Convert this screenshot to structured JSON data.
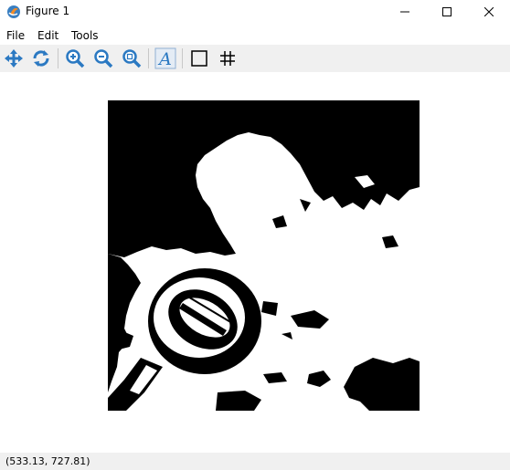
{
  "window": {
    "title": "Figure 1"
  },
  "menu": {
    "items": [
      "File",
      "Edit",
      "Tools"
    ]
  },
  "toolbar": {
    "buttons": [
      "pan-icon",
      "reset-view-icon",
      "zoom-in-icon",
      "zoom-out-icon",
      "zoom-rect-icon",
      "text-tool-icon",
      "rectangle-icon",
      "grid-icon"
    ],
    "text_glyph": "A"
  },
  "statusbar": {
    "coords": "(533.13, 727.81)"
  },
  "colors": {
    "toolbar_bg": "#f0f0f0",
    "icon_blue": "#2b79c2"
  }
}
